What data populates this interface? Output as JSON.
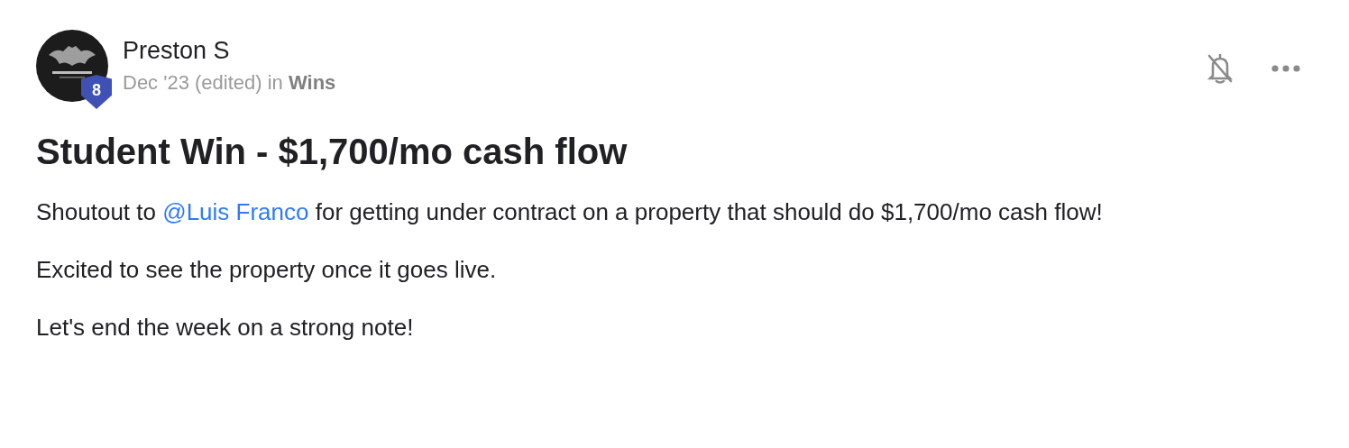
{
  "post": {
    "author": "Preston S",
    "level_badge": "8",
    "meta": "Dec '23 (edited) in **Wins**",
    "title": "Student Win - $1,700/mo cash flow",
    "paragraphs": [
      {
        "parts": [
          {
            "kind": "text",
            "text": "Shoutout to "
          },
          {
            "kind": "mention",
            "text": "@Luis Franco"
          },
          {
            "kind": "text",
            "text": " for getting under contract on a property that should do $1,700/mo cash flow!"
          }
        ]
      },
      {
        "parts": [
          {
            "kind": "text",
            "text": "Excited to see the property once it goes live."
          }
        ]
      },
      {
        "parts": [
          {
            "kind": "text",
            "text": "Let's end the week on a strong note!"
          }
        ]
      }
    ]
  }
}
